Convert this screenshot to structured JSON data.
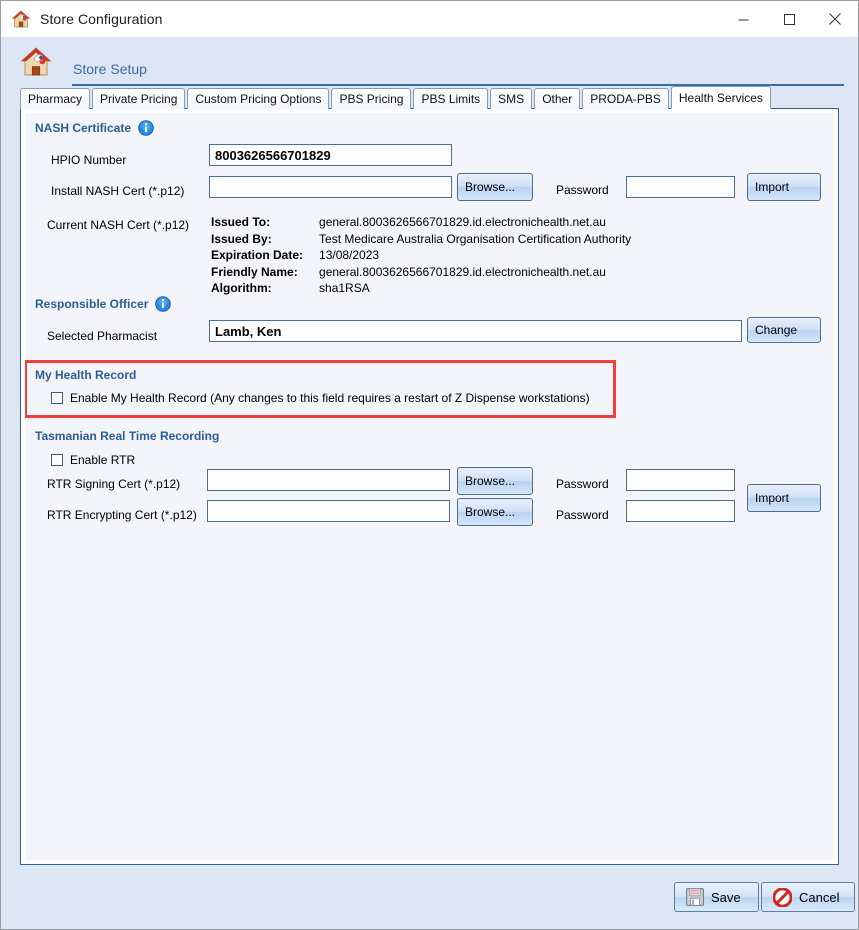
{
  "window": {
    "title": "Store Configuration",
    "icon": "pharmacy-house-icon",
    "controls": {
      "minimize": "minimize-icon",
      "maximize": "maximize-icon",
      "close": "close-icon"
    }
  },
  "header": {
    "title": "Store Setup",
    "icon": "pharmacy-house-icon"
  },
  "tabs": [
    {
      "label": "Pharmacy",
      "active": false
    },
    {
      "label": "Private Pricing",
      "active": false
    },
    {
      "label": "Custom Pricing Options",
      "active": false
    },
    {
      "label": "PBS Pricing",
      "active": false
    },
    {
      "label": "PBS Limits",
      "active": false
    },
    {
      "label": "SMS",
      "active": false
    },
    {
      "label": "Other",
      "active": false
    },
    {
      "label": "PRODA-PBS",
      "active": false
    },
    {
      "label": "Health Services",
      "active": true
    }
  ],
  "nash": {
    "section_title": "NASH Certificate",
    "hpio_label": "HPIO Number",
    "hpio_value": "8003626566701829",
    "install_label": "Install NASH Cert (*.p12)",
    "install_value": "",
    "browse_label": "Browse...",
    "password_label": "Password",
    "password_value": "",
    "import_label": "Import",
    "current_label": "Current NASH Cert (*.p12)",
    "details": [
      {
        "key": "Issued To:",
        "value": "general.8003626566701829.id.electronichealth.net.au"
      },
      {
        "key": "Issued By:",
        "value": "Test Medicare Australia Organisation Certification Authority"
      },
      {
        "key": "Expiration Date:",
        "value": "13/08/2023"
      },
      {
        "key": "Friendly Name:",
        "value": "general.8003626566701829.id.electronichealth.net.au"
      },
      {
        "key": "Algorithm:",
        "value": "sha1RSA"
      }
    ]
  },
  "responsible_officer": {
    "section_title": "Responsible Officer",
    "pharmacist_label": "Selected Pharmacist",
    "pharmacist_value": "Lamb, Ken",
    "change_label": "Change"
  },
  "my_health_record": {
    "section_title": "My Health Record",
    "enable_label": "Enable My Health Record (Any changes to this field requires a restart of Z Dispense workstations)",
    "enabled": false,
    "highlight_color": "#f4403a"
  },
  "rtr": {
    "section_title": "Tasmanian Real Time Recording",
    "enable_label": "Enable RTR",
    "enabled": false,
    "signing_label": "RTR Signing Cert (*.p12)",
    "signing_value": "",
    "signing_browse_label": "Browse...",
    "signing_password_label": "Password",
    "signing_password_value": "",
    "encrypting_label": "RTR Encrypting Cert (*.p12)",
    "encrypting_value": "",
    "encrypting_browse_label": "Browse...",
    "encrypting_password_label": "Password",
    "encrypting_password_value": "",
    "import_label": "Import"
  },
  "footer": {
    "save_label": "Save",
    "cancel_label": "Cancel"
  }
}
